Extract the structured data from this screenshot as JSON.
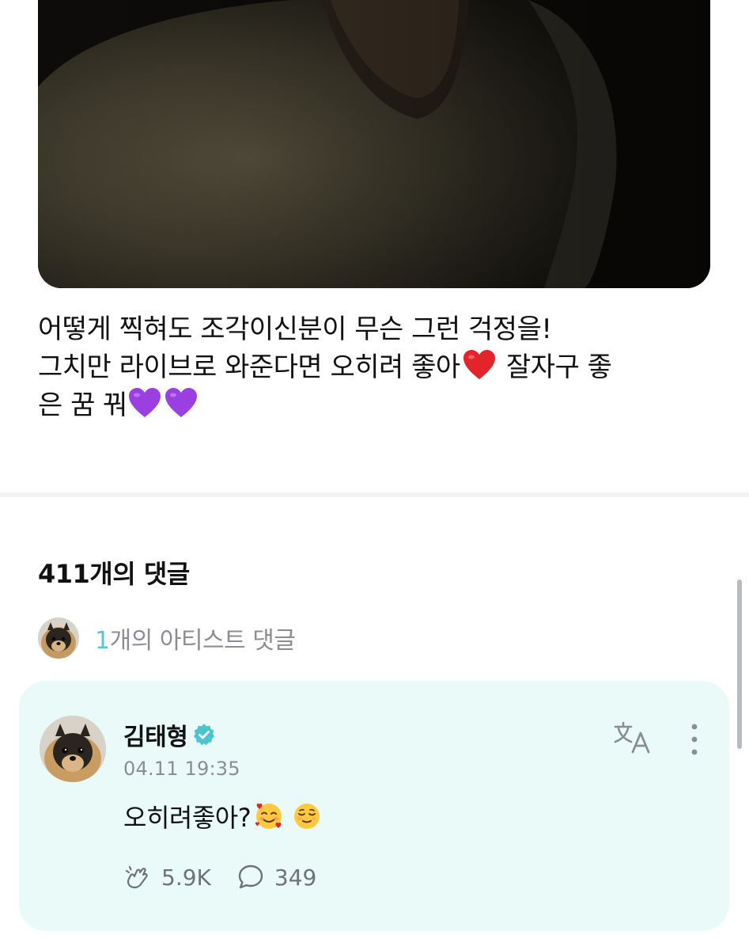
{
  "post": {
    "media": {
      "description_icon": "photo"
    },
    "text_lines": [
      "어떻게 찍혀도 조각이신분이 무슨 그런 걱정을!",
      "그치만 라이브로 와준다면 오히려 좋아",
      " 잘자구 좋",
      "은 꿈 꿔"
    ]
  },
  "comments": {
    "count_label": "411개의 댓글",
    "artist_summary": {
      "count": "1",
      "label": "개의 아티스트 댓글"
    },
    "artist_comment": {
      "author": "김태형",
      "timestamp": "04.11 19:35",
      "body": "오히려좋아?",
      "likes": "5.9K",
      "replies": "349",
      "translate_icon": "translate-icon",
      "more_icon": "more-vertical-icon"
    }
  },
  "colors": {
    "accent": "#58c6d4",
    "card_background": "#e9faf8",
    "muted_text": "#8a8d93",
    "verified": "#4ac4cf"
  }
}
